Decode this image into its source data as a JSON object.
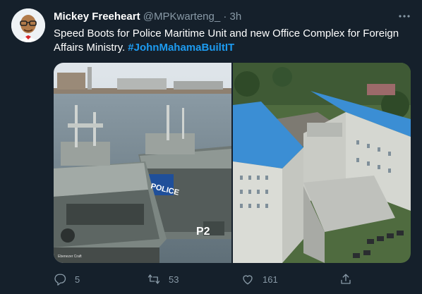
{
  "tweet": {
    "author_name": "Mickey Freeheart",
    "author_handle": "@MPKwarteng_",
    "separator": " · ",
    "time": "3h",
    "text": "Speed Boots for Police Maritime Unit and new Office Complex for Foreign Affairs Ministry. ",
    "hashtag": "#JohnMahamaBuiltIT",
    "media_left": {
      "boat_label_police": "POLICE",
      "boat_label_p2": "P2",
      "watermark": "Ebenezer Craft"
    },
    "stats": {
      "replies": "5",
      "retweets": "53",
      "likes": "161"
    }
  },
  "colors": {
    "background": "#15202b",
    "accent": "#1d9bf0",
    "muted": "#8899a6"
  },
  "icons": [
    "more-icon",
    "reply-icon",
    "retweet-icon",
    "like-icon",
    "share-icon"
  ]
}
